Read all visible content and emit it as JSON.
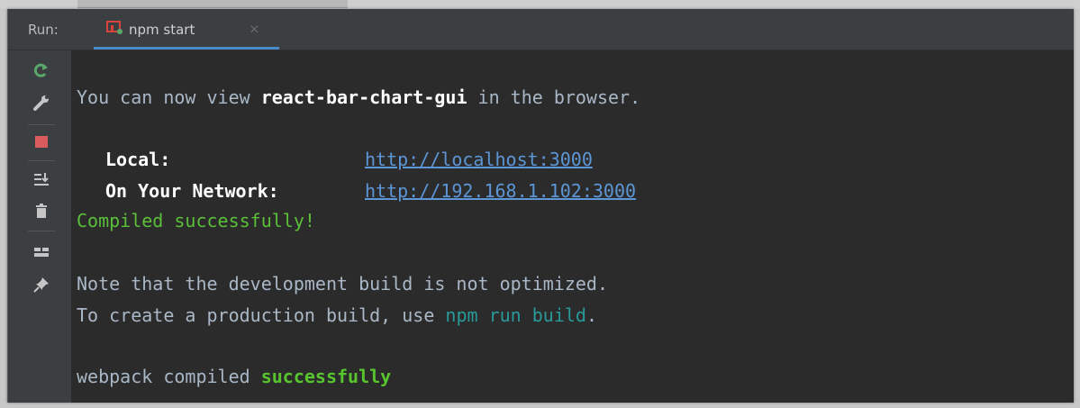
{
  "run_panel": {
    "label": "Run:",
    "tab": {
      "label": "npm start",
      "close": "×"
    }
  },
  "toolbar": {
    "items": [
      {
        "icon": "rerun-icon"
      },
      {
        "icon": "wrench-icon"
      },
      {
        "icon": "stop-icon"
      },
      {
        "icon": "scroll-to-end-icon"
      },
      {
        "icon": "trash-icon"
      },
      {
        "icon": "layout-icon"
      },
      {
        "icon": "pin-icon"
      }
    ]
  },
  "console": {
    "line1": {
      "prefix": "You can now view ",
      "app": "react-bar-chart-gui",
      "suffix": " in the browser."
    },
    "local": {
      "label": "Local:",
      "url": "http://localhost:3000"
    },
    "network": {
      "label": "On Your Network:",
      "url": "http://192.168.1.102:3000"
    },
    "compiled": "Compiled successfully!",
    "note": "Note that the development build is not optimized.",
    "prod": {
      "prefix": "To create a production build, use ",
      "cmd": "npm run build",
      "suffix": "."
    },
    "webpack": {
      "prefix": "webpack compiled ",
      "status": "successfully"
    }
  },
  "colors": {
    "background": "#2b2b2b",
    "panel": "#3c3f41",
    "text": "#a9b7c6",
    "link": "#5c96d6",
    "success": "#5bbf3a",
    "command": "#299999",
    "stop": "#db5c5c",
    "tab_accent": "#4a88c7"
  }
}
